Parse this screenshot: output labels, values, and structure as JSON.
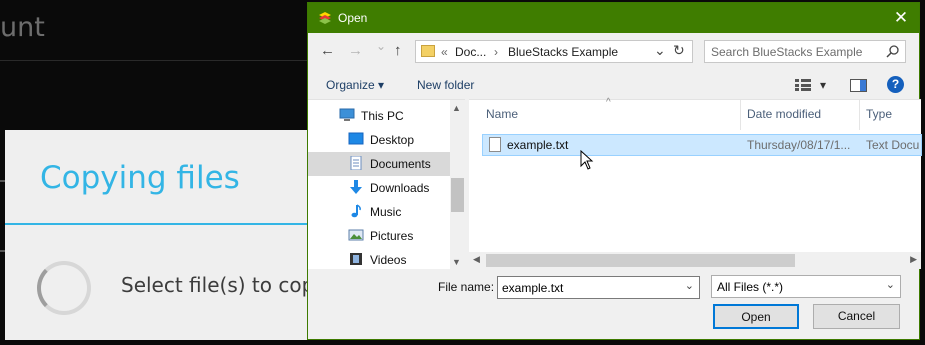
{
  "background": {
    "header_title": "unt",
    "dialog_title": "Copying files",
    "dialog_message": "Select file(s) to copy"
  },
  "dialog": {
    "title": "Open",
    "close_glyph": "✕",
    "nav": {
      "back": "←",
      "forward": "→",
      "recent": "⌄",
      "up": "↑",
      "breadcrumb_overflow": "«",
      "crumbs": [
        "Doc...",
        "BlueStacks Example"
      ],
      "separator": "›",
      "dropdown": "⌄",
      "refresh": "↻",
      "search_placeholder": "Search BlueStacks Example"
    },
    "toolbar": {
      "organize": "Organize ▾",
      "new_folder": "New folder",
      "views_arrow": "▾",
      "help": "?"
    },
    "nav_pane": [
      {
        "label": "This PC",
        "icon": "computer-icon"
      },
      {
        "label": "Desktop",
        "icon": "desktop-icon"
      },
      {
        "label": "Documents",
        "icon": "documents-icon",
        "selected": true
      },
      {
        "label": "Downloads",
        "icon": "downloads-icon"
      },
      {
        "label": "Music",
        "icon": "music-icon"
      },
      {
        "label": "Pictures",
        "icon": "pictures-icon"
      },
      {
        "label": "Videos",
        "icon": "videos-icon"
      }
    ],
    "columns": {
      "name": "Name",
      "date_modified": "Date modified",
      "type": "Type"
    },
    "files": [
      {
        "name": "example.txt",
        "date_modified": "Thursday/08/17/1...",
        "type": "Text Docu",
        "selected": true
      }
    ],
    "file_name_label": "File name:",
    "file_name_value": "example.txt",
    "filter_value": "All Files (*.*)",
    "open_button": "Open",
    "cancel_button": "Cancel"
  },
  "colors": {
    "titlebar": "#3f7d00",
    "accent": "#33b5e5",
    "selection": "#cce8ff"
  }
}
